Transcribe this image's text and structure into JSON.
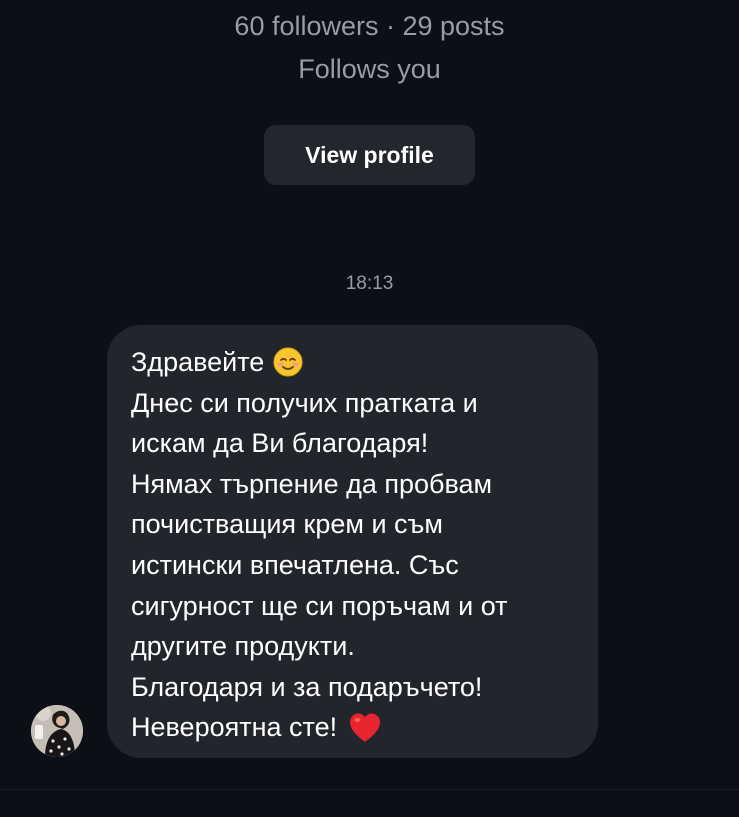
{
  "profile": {
    "stats": "60 followers · 29 posts",
    "relationship": "Follows you",
    "view_profile_label": "View profile"
  },
  "conversation": {
    "timestamp": "18:13",
    "message": {
      "lines": [
        "Здравейте",
        "Днес си получих пратката и",
        "искам да Ви благодаря!",
        "Нямах търпение да пробвам",
        "почистващия крем и съм",
        "истински впечатлена. Със",
        "сигурност ще си поръчам и от",
        "другите продукти.",
        "Благодаря и за подаръчето!",
        "Невероятна сте!"
      ],
      "emoji_after_line_1": "smiling-face-icon",
      "emoji_after_line_10": "red-heart-icon"
    }
  },
  "colors": {
    "background": "#0d0f16",
    "bubble": "#23252c",
    "button": "#24262d",
    "secondary_text": "#9a9ca3",
    "heart": "#e8242f"
  }
}
